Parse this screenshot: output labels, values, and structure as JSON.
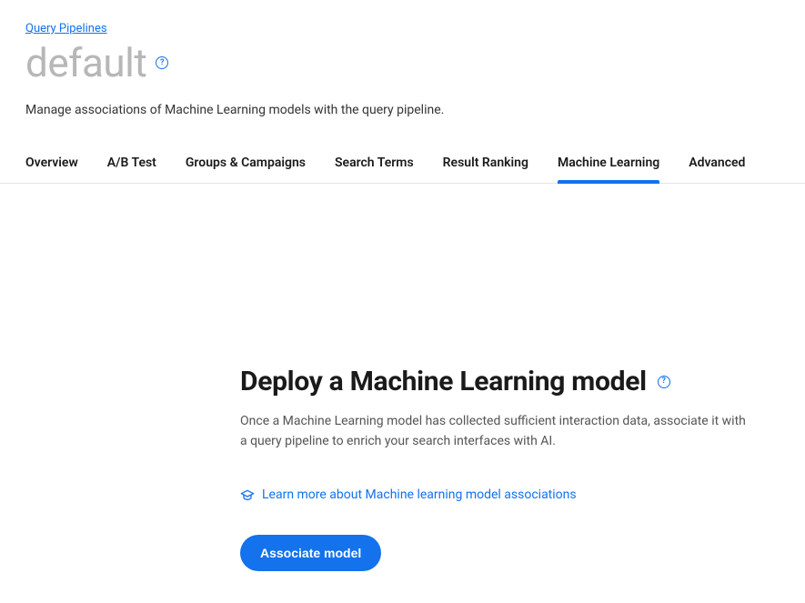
{
  "breadcrumb": "Query Pipelines",
  "page_title": "default",
  "subtitle": "Manage associations of Machine Learning models with the query pipeline.",
  "tabs": {
    "overview": "Overview",
    "abtest": "A/B Test",
    "groups": "Groups & Campaigns",
    "search_terms": "Search Terms",
    "result_ranking": "Result Ranking",
    "machine_learning": "Machine Learning",
    "advanced": "Advanced"
  },
  "deploy": {
    "title": "Deploy a Machine Learning model",
    "description": "Once a Machine Learning model has collected sufficient interaction data, associate it with a query pipeline to enrich your search interfaces with AI.",
    "learn_more": "Learn more about Machine learning model associations",
    "button": "Associate model"
  },
  "help_glyph": "?"
}
